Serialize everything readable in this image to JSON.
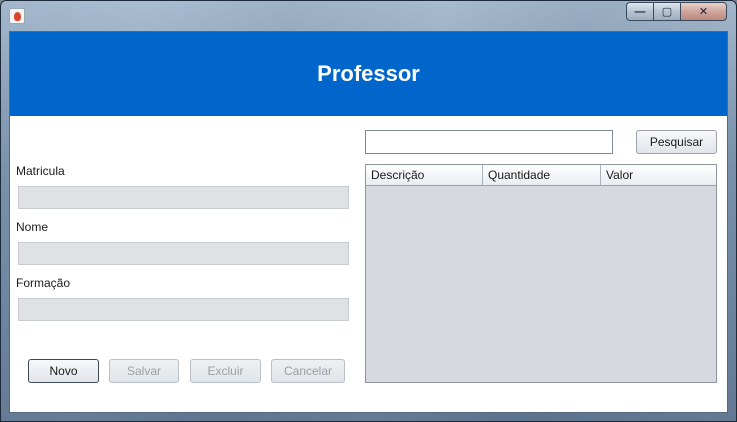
{
  "window": {
    "app_icon": "java-cup-icon",
    "controls": {
      "minimize": "—",
      "maximize": "▢",
      "close": "✕"
    }
  },
  "header": {
    "title": "Professor"
  },
  "form": {
    "matricula_label": "Matricula",
    "matricula_value": "",
    "nome_label": "Nome",
    "nome_value": "",
    "formacao_label": "Formação",
    "formacao_value": ""
  },
  "buttons": {
    "novo": "Novo",
    "salvar": "Salvar",
    "excluir": "Excluir",
    "cancelar": "Cancelar"
  },
  "search": {
    "value": "",
    "button_label": "Pesquisar"
  },
  "table": {
    "columns": [
      "Descrição",
      "Quantidade",
      "Valor"
    ],
    "rows": []
  },
  "colors": {
    "banner": "#0066cc",
    "field_background": "#dfe1e5",
    "table_background": "#d6d9df"
  }
}
